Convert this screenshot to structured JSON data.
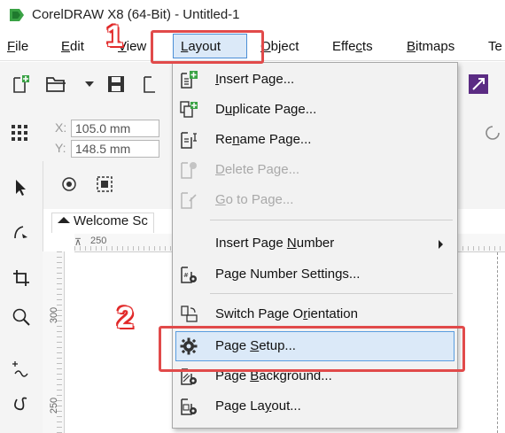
{
  "window": {
    "title": "CorelDRAW X8 (64-Bit) - Untitled-1"
  },
  "menubar": {
    "items": [
      {
        "label": "File",
        "accel": "F",
        "rest": "ile"
      },
      {
        "label": "Edit",
        "accel": "E",
        "rest": "dit"
      },
      {
        "label": "View",
        "accel": "V",
        "rest": "iew"
      },
      {
        "label": "Layout",
        "accel": "L",
        "rest": "ayout"
      },
      {
        "label": "Object",
        "accel": "O",
        "rest": "bject"
      },
      {
        "label": "Effects",
        "pre": "Effe",
        "accel": "c",
        "rest": "ts"
      },
      {
        "label": "Bitmaps",
        "accel": "B",
        "rest": "itmaps"
      },
      {
        "label": "Te",
        "accel": "",
        "rest": "Te"
      }
    ]
  },
  "propbar": {
    "x_label": "X:",
    "x_value": "105.0 mm",
    "y_label": "Y:",
    "y_value": "148.5 mm"
  },
  "document": {
    "tab_label": "Welcome Sc",
    "ruler_top_mark": "250",
    "ruler_left_marks": [
      "300",
      "250"
    ]
  },
  "callouts": {
    "step1": "1",
    "step2": "2"
  },
  "layout_menu": {
    "items": [
      {
        "pre": "",
        "accel": "I",
        "rest": "nsert Page...",
        "enabled": true
      },
      {
        "pre": "D",
        "accel": "u",
        "rest": "plicate Page...",
        "enabled": true
      },
      {
        "pre": "Re",
        "accel": "n",
        "rest": "ame Page...",
        "enabled": true
      },
      {
        "pre": "",
        "accel": "D",
        "rest": "elete Page...",
        "enabled": false
      },
      {
        "pre": "",
        "accel": "G",
        "rest": "o to Page...",
        "enabled": false
      },
      {
        "pre": "Insert Page ",
        "accel": "N",
        "rest": "umber",
        "enabled": true
      },
      {
        "pre": "Pa",
        "accel": "g",
        "rest": "e Number Settings...",
        "enabled": true
      },
      {
        "pre": "Switch Page O",
        "accel": "r",
        "rest": "ientation",
        "enabled": true
      },
      {
        "pre": "Page ",
        "accel": "S",
        "rest": "etup...",
        "enabled": true
      },
      {
        "pre": "Page ",
        "accel": "B",
        "rest": "ackground...",
        "enabled": true
      },
      {
        "pre": "Page La",
        "accel": "y",
        "rest": "out...",
        "enabled": true
      }
    ]
  },
  "colors": {
    "highlight_red": "#e14a4a",
    "menu_hover": "#dbe9f8",
    "logo_green": "#3aa245"
  }
}
